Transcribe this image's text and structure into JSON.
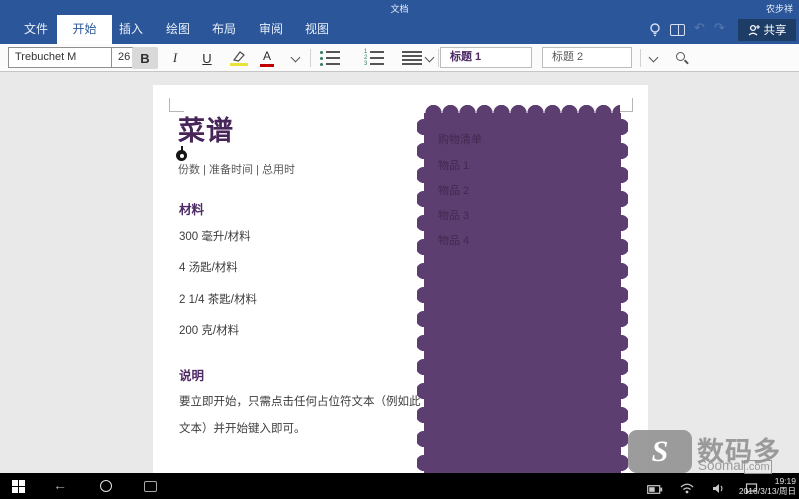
{
  "window": {
    "title": "文档",
    "user": "农步祥"
  },
  "ribbon": {
    "tabs": [
      "文件",
      "开始",
      "插入",
      "绘图",
      "布局",
      "审阅",
      "视图"
    ],
    "active_tab": "开始",
    "share_label": "共享"
  },
  "toolbar": {
    "font_name": "Trebuchet M",
    "font_size": "26",
    "bold": "B",
    "italic": "I",
    "underline": "U",
    "font_color_letter": "A",
    "style_heading1": "标题 1",
    "style_heading2": "标题 2"
  },
  "document": {
    "title": "菜谱",
    "meta": "份数 | 准备时间 | 总用时",
    "ingredients_heading": "材料",
    "ingredients": [
      "300 毫升/材料",
      "4 汤匙/材料",
      "2 1/4 茶匙/材料",
      "200 克/材料"
    ],
    "instructions_heading": "说明",
    "instructions_lines": [
      "要立即开始，只需点击任何占位符文本（例如此",
      "文本）并开始键入即可。"
    ],
    "shopping_list": {
      "title": "购物清单",
      "items": [
        "物品 1",
        "物品 2",
        "物品 3",
        "物品 4"
      ]
    }
  },
  "watermark": {
    "logo_letter": "S",
    "brand": "数码多",
    "site": "Soomal",
    "site_suffix": ".com"
  },
  "taskbar": {
    "time": "19:19",
    "date": "2016/3/13/周日"
  },
  "colors": {
    "word_blue": "#2b579a",
    "share_button_blue": "#1d3c66",
    "accent_purple": "#5c3e70",
    "heading_purple": "#4f2b66",
    "highlight_yellow": "#e9e337",
    "font_color_red": "#c00000"
  }
}
